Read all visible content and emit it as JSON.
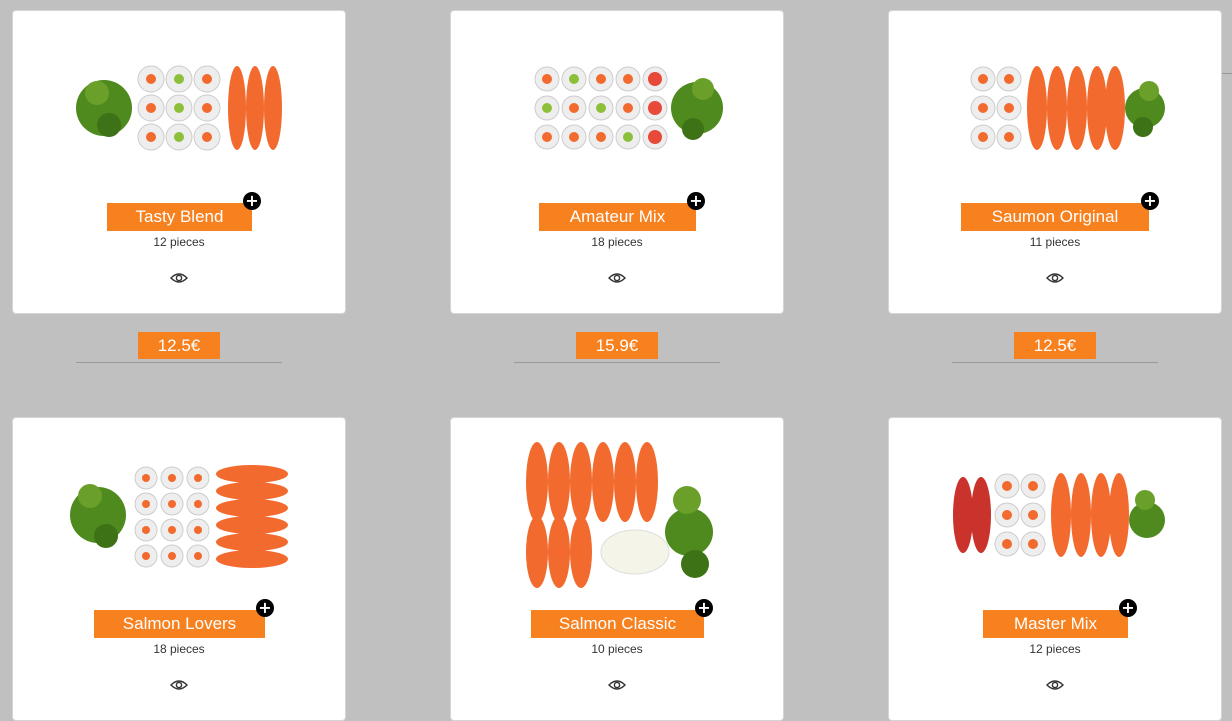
{
  "products": [
    {
      "name": "Tasty Blend",
      "pieces": "12 pieces",
      "price": "12.5€",
      "add_icon": "plus-icon",
      "view_icon": "eye-icon"
    },
    {
      "name": "Amateur Mix",
      "pieces": "18 pieces",
      "price": "15.9€",
      "add_icon": "plus-icon",
      "view_icon": "eye-icon"
    },
    {
      "name": "Saumon Original",
      "pieces": "11 pieces",
      "price": "12.5€",
      "add_icon": "plus-icon",
      "view_icon": "eye-icon"
    },
    {
      "name": "Salmon Lovers",
      "pieces": "18 pieces",
      "add_icon": "plus-icon",
      "view_icon": "eye-icon"
    },
    {
      "name": "Salmon Classic",
      "pieces": "10 pieces",
      "add_icon": "plus-icon",
      "view_icon": "eye-icon"
    },
    {
      "name": "Master Mix",
      "pieces": "12 pieces",
      "add_icon": "plus-icon",
      "view_icon": "eye-icon"
    }
  ],
  "colors": {
    "accent": "#f7801f",
    "background": "#c0c0c0",
    "card": "#ffffff",
    "salmon": "#f26a2e",
    "edamame": "#4e8a1e"
  }
}
